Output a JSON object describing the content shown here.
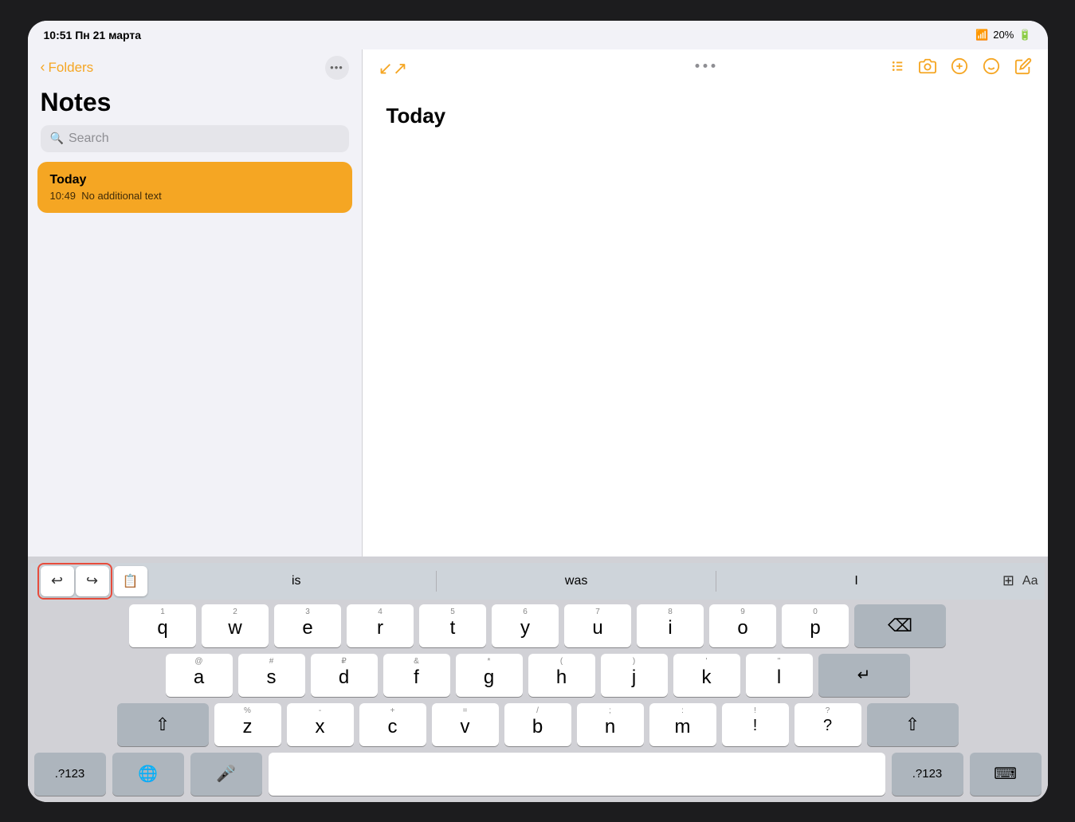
{
  "statusBar": {
    "time": "10:51",
    "date": "Пн 21 марта",
    "wifi": "📶",
    "battery": "20%"
  },
  "sidebar": {
    "backLabel": "Folders",
    "title": "Notes",
    "searchPlaceholder": "Search",
    "moreIcon": "•••",
    "noteItem": {
      "title": "Today",
      "time": "10:49",
      "preview": "No additional text"
    }
  },
  "noteArea": {
    "heading": "Today",
    "dotsLabel": "•••",
    "expandIcon": "↙↗",
    "toolbarIcons": [
      "checklist",
      "camera",
      "compass",
      "emoji",
      "new-note"
    ]
  },
  "keyboardToolbar": {
    "undoLabel": "↩",
    "redoLabel": "↪",
    "clipboardLabel": "📋",
    "suggestions": [
      "is",
      "was",
      "I"
    ],
    "tableIcon": "⊞",
    "aaLabel": "Aa"
  },
  "keyboard": {
    "row1": [
      {
        "num": "1",
        "letter": "q"
      },
      {
        "num": "2",
        "letter": "w"
      },
      {
        "num": "3",
        "letter": "e"
      },
      {
        "num": "4",
        "letter": "r"
      },
      {
        "num": "5",
        "letter": "t"
      },
      {
        "num": "6",
        "letter": "y"
      },
      {
        "num": "7",
        "letter": "u"
      },
      {
        "num": "8",
        "letter": "i"
      },
      {
        "num": "9",
        "letter": "o"
      },
      {
        "num": "0",
        "letter": "p"
      }
    ],
    "row2": [
      {
        "num": "@",
        "letter": "a"
      },
      {
        "num": "#",
        "letter": "s"
      },
      {
        "num": "₽",
        "letter": "d"
      },
      {
        "num": "&",
        "letter": "f"
      },
      {
        "num": "*",
        "letter": "g"
      },
      {
        "num": "(",
        "letter": "h"
      },
      {
        "num": ")",
        "letter": "j"
      },
      {
        "num": "'",
        "letter": "k"
      },
      {
        "num": "\"",
        "letter": "l"
      }
    ],
    "row3": [
      {
        "num": "%",
        "letter": "z"
      },
      {
        "num": "-",
        "letter": "x"
      },
      {
        "num": "+",
        "letter": "c"
      },
      {
        "num": "=",
        "letter": "v"
      },
      {
        "num": "/",
        "letter": "b"
      },
      {
        "num": ";",
        "letter": "n"
      },
      {
        "num": ":",
        "letter": "m"
      }
    ],
    "row4": {
      "num123": ".?123",
      "globe": "🌐",
      "mic": "🎤",
      "spaceLabel": "",
      "num123Right": ".?123",
      "hideKb": "⌨"
    }
  },
  "colors": {
    "accent": "#f5a623",
    "keyBackground": "#ffffff",
    "grayKey": "#adb5bd",
    "keyboardBg": "#d1d1d6"
  }
}
